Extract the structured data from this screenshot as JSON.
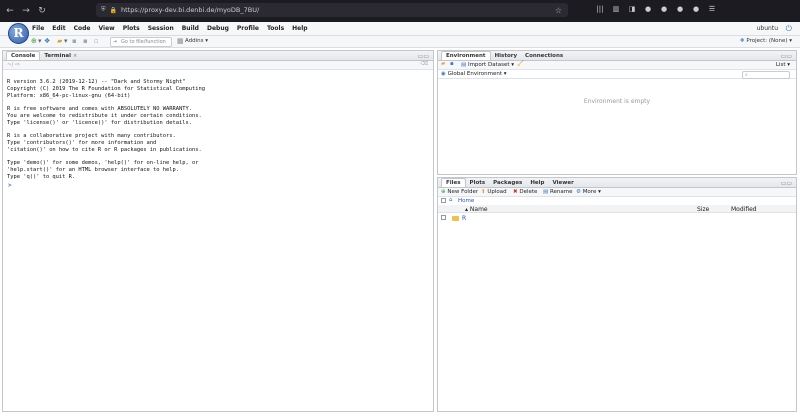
{
  "browser": {
    "url": "https://proxy-dev.bi.denbi.de/myoDB_7BU/",
    "extensions": [
      "|||",
      "▥",
      "◨",
      "●",
      "●",
      "●",
      "●",
      "☰"
    ]
  },
  "menubar": {
    "items": [
      "File",
      "Edit",
      "Code",
      "View",
      "Plots",
      "Session",
      "Build",
      "Debug",
      "Profile",
      "Tools",
      "Help"
    ],
    "user": "ubuntu"
  },
  "toolbar": {
    "goto_placeholder": "Go to file/function",
    "addins": "Addins",
    "project": "Project: (None)"
  },
  "console": {
    "tabs": [
      "Console",
      "Terminal"
    ],
    "startup_lines": [
      "R version 3.6.2 (2019-12-12) -- \"Dark and Stormy Night\"",
      "Copyright (C) 2019 The R Foundation for Statistical Computing",
      "Platform: x86_64-pc-linux-gnu (64-bit)",
      "",
      "R is free software and comes with ABSOLUTELY NO WARRANTY.",
      "You are welcome to redistribute it under certain conditions.",
      "Type 'license()' or 'licence()' for distribution details.",
      "",
      "R is a collaborative project with many contributors.",
      "Type 'contributors()' for more information and",
      "'citation()' on how to cite R or R packages in publications.",
      "",
      "Type 'demo()' for some demos, 'help()' for on-line help, or",
      "'help.start()' for an HTML browser interface to help.",
      "Type 'q()' to quit R."
    ],
    "prompt": ">"
  },
  "environment": {
    "tabs": [
      "Environment",
      "History",
      "Connections"
    ],
    "import_label": "Import Dataset",
    "list_label": "List",
    "scope": "Global Environment",
    "empty_message": "Environment is empty"
  },
  "files": {
    "tabs": [
      "Files",
      "Plots",
      "Packages",
      "Help",
      "Viewer"
    ],
    "actions": {
      "new_folder": "New Folder",
      "upload": "Upload",
      "delete": "Delete",
      "rename": "Rename",
      "more": "More"
    },
    "breadcrumb": "Home",
    "columns": [
      "Name",
      "Size",
      "Modified"
    ],
    "rows": [
      {
        "name": "R",
        "size": "",
        "modified": ""
      }
    ]
  }
}
